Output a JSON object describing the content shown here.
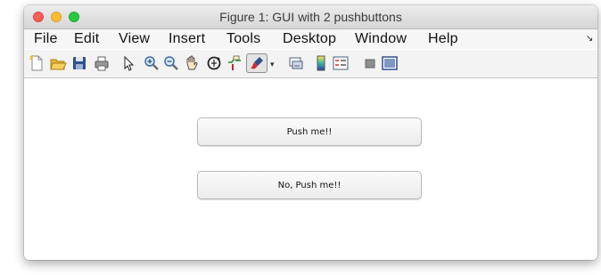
{
  "window": {
    "title": "Figure 1: GUI with 2 pushbuttons"
  },
  "menubar": {
    "items": [
      "File",
      "Edit",
      "View",
      "Insert",
      "Tools",
      "Desktop",
      "Window",
      "Help"
    ],
    "overflow_icon": "expand-arrow-icon"
  },
  "toolbar": {
    "icons": [
      "new-figure-icon",
      "open-file-icon",
      "save-icon",
      "print-icon",
      "pointer-icon",
      "zoom-in-icon",
      "zoom-out-icon",
      "pan-hand-icon",
      "rotate-3d-icon",
      "data-cursor-icon",
      "brush-icon",
      "link-plot-icon",
      "colorbar-icon",
      "legend-icon",
      "hide-plot-tools-icon",
      "show-plot-tools-icon"
    ]
  },
  "buttons": {
    "push_me": "Push me!!",
    "no_push_me": "No, Push me!!"
  },
  "colors": {
    "close": "#fc5f57",
    "minimize": "#fdbc2e",
    "maximize": "#28c840"
  }
}
